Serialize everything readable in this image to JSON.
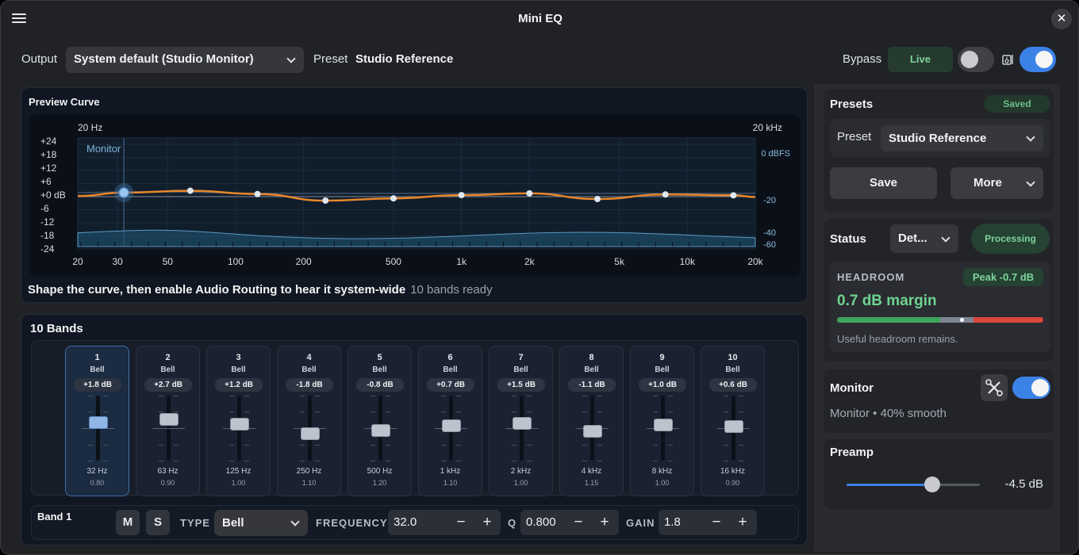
{
  "app": {
    "title": "Mini EQ"
  },
  "toolbar": {
    "output_label": "Output",
    "output_value": "System default (Studio Monitor)",
    "preset_label": "Preset",
    "preset_value": "Studio Reference",
    "bypass_label": "Bypass",
    "live_badge": "Live",
    "bypass_on": false,
    "routing_on": true
  },
  "preview": {
    "title": "Preview Curve",
    "freq_low": "20 Hz",
    "freq_high": "20 kHz",
    "monitor_label": "Monitor",
    "db_ticks": [
      "+24",
      "+18",
      "+12",
      "+6",
      "+0 dB",
      "-6",
      "-12",
      "-18",
      "-24"
    ],
    "right_ticks": [
      "0 dBFS",
      "-20",
      "-40",
      "-60"
    ],
    "x_ticks": [
      "20",
      "30",
      "50",
      "100",
      "200",
      "500",
      "1k",
      "2k",
      "5k",
      "10k",
      "20k"
    ],
    "hint": "Shape the curve, then enable Audio Routing to hear it system-wide",
    "hint_status": "10 bands ready"
  },
  "bands": {
    "title": "10 Bands",
    "items": [
      {
        "num": "1",
        "type": "Bell",
        "gain": "+1.8 dB",
        "freq": "32 Hz",
        "q": "0.80",
        "value": 1.8,
        "selected": true
      },
      {
        "num": "2",
        "type": "Bell",
        "gain": "+2.7 dB",
        "freq": "63 Hz",
        "q": "0.90",
        "value": 2.7
      },
      {
        "num": "3",
        "type": "Bell",
        "gain": "+1.2 dB",
        "freq": "125 Hz",
        "q": "1.00",
        "value": 1.2
      },
      {
        "num": "4",
        "type": "Bell",
        "gain": "-1.8 dB",
        "freq": "250 Hz",
        "q": "1.10",
        "value": -1.8
      },
      {
        "num": "5",
        "type": "Bell",
        "gain": "-0.8 dB",
        "freq": "500 Hz",
        "q": "1.20",
        "value": -0.8
      },
      {
        "num": "6",
        "type": "Bell",
        "gain": "+0.7 dB",
        "freq": "1 kHz",
        "q": "1.10",
        "value": 0.7
      },
      {
        "num": "7",
        "type": "Bell",
        "gain": "+1.5 dB",
        "freq": "2 kHz",
        "q": "1.00",
        "value": 1.5
      },
      {
        "num": "8",
        "type": "Bell",
        "gain": "-1.1 dB",
        "freq": "4 kHz",
        "q": "1.15",
        "value": -1.1
      },
      {
        "num": "9",
        "type": "Bell",
        "gain": "+1.0 dB",
        "freq": "8 kHz",
        "q": "1.00",
        "value": 1.0
      },
      {
        "num": "10",
        "type": "Bell",
        "gain": "+0.6 dB",
        "freq": "16 kHz",
        "q": "0.90",
        "value": 0.6
      }
    ]
  },
  "band_edit": {
    "name": "Band 1",
    "mute": "M",
    "solo": "S",
    "type_label": "TYPE",
    "type_value": "Bell",
    "freq_label": "FREQUENCY",
    "freq_value": "32.0",
    "q_label": "Q",
    "q_value": "0.800",
    "gain_label": "GAIN",
    "gain_value": "1.8",
    "minus": "−",
    "plus": "+"
  },
  "presets_card": {
    "title": "Presets",
    "badge": "Saved",
    "preset_label": "Preset",
    "preset_value": "Studio Reference",
    "save": "Save",
    "more": "More"
  },
  "status_card": {
    "title": "Status",
    "mode_value": "Det...",
    "processing": "Processing",
    "headroom_label": "HEADROOM",
    "peak": "Peak -0.7 dB",
    "margin": "0.7 dB margin",
    "note": "Useful headroom remains.",
    "meter_green": 0.5,
    "meter_gray": 0.16,
    "meter_red": 0.34
  },
  "monitor_card": {
    "title": "Monitor",
    "subtitle": "Monitor • 40% smooth",
    "enabled": true
  },
  "preamp_card": {
    "title": "Preamp",
    "value": "-4.5 dB",
    "level": 0.64
  },
  "colors": {
    "accent": "#3b82e6",
    "curve": "#e8862b",
    "green": "#7fd39d",
    "red": "#d9473a"
  }
}
